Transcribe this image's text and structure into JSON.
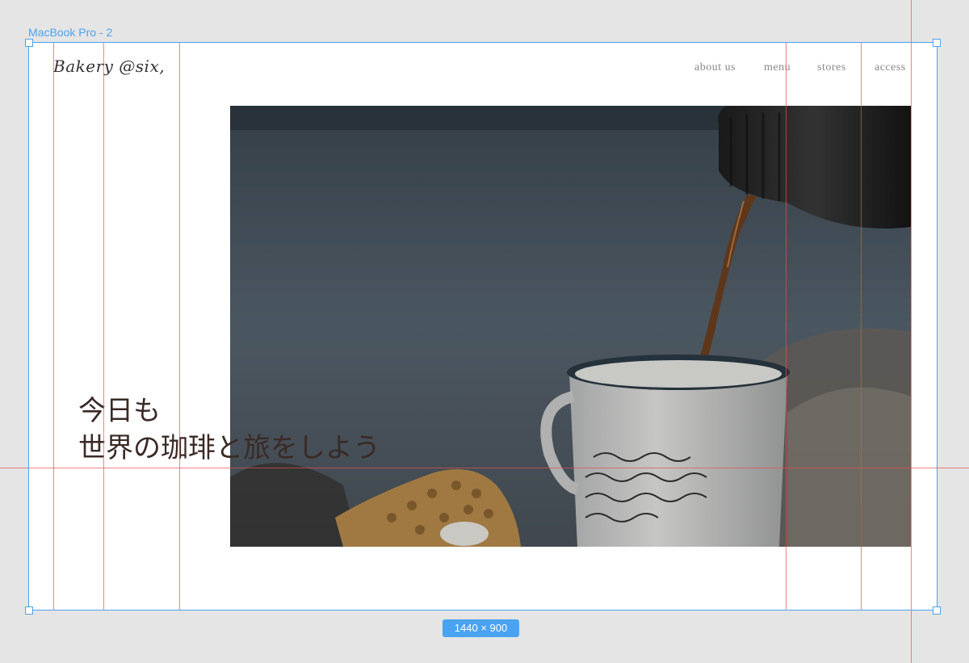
{
  "frame": {
    "label": "MacBook Pro - 2",
    "size_badge": "1440 × 900"
  },
  "site": {
    "brand": "Bakery @six,",
    "nav": [
      {
        "label": "about us"
      },
      {
        "label": "menu"
      },
      {
        "label": "stores"
      },
      {
        "label": "access"
      }
    ],
    "headline": {
      "line1": "今日も",
      "line2": "世界の珈琲と旅をしよう"
    },
    "hero_image": {
      "subject": "coffee poured from a thermos into an enamel mug"
    }
  },
  "colors": {
    "selection": "#4aa3f0",
    "guide": "#e65050",
    "canvas_bg": "#e5e5e5",
    "headline_text": "#3a2a25",
    "nav_text": "#888888"
  }
}
